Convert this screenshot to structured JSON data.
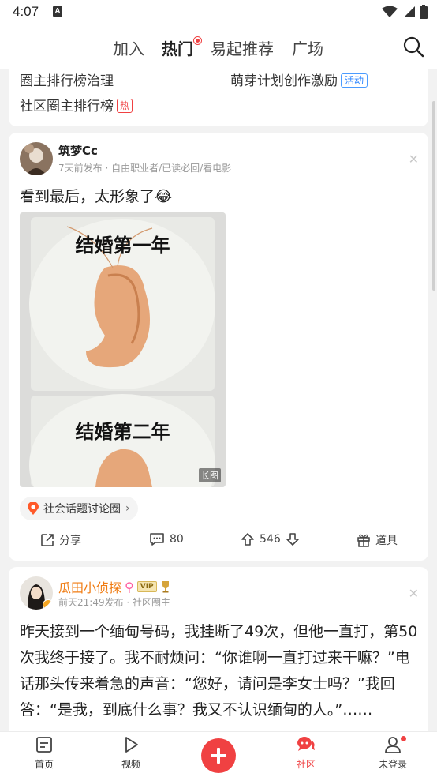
{
  "status_bar": {
    "time": "4:07",
    "badge": "A"
  },
  "top_nav": {
    "tabs": [
      {
        "label": "加入"
      },
      {
        "label": "热门",
        "active": true
      },
      {
        "label": "易起推荐"
      },
      {
        "label": "广场"
      }
    ]
  },
  "top_card": {
    "link1": "圈主排行榜治理",
    "link2": "社区圈主排行榜",
    "link2_tag": "热",
    "link3": "萌芽计划创作激励",
    "link3_tag": "活动"
  },
  "post1": {
    "author": "筑梦Cc",
    "meta": "7天前发布 · 自由职业者/已读必回/看电影",
    "text": "看到最后，太形象了😂",
    "image": {
      "caption1": "结婚第一年",
      "caption2": "结婚第二年",
      "long_badge": "长图"
    },
    "circle": "社会话题讨论圈",
    "actions": {
      "share": "分享",
      "comments": "80",
      "votes": "546",
      "props": "道具"
    }
  },
  "post2": {
    "author": "瓜田小侦探",
    "vip": "VIP",
    "meta": "前天21:49发布 · 社区圈主",
    "text": "昨天接到一个缅甸号码，我挂断了49次，但他一直打，第50次我终于接了。我不耐烦问：“你谁啊一直打过来干嘛？”电话那头传来着急的声音：“您好，请问是李女士吗？”我回答：“是我，到底什么事？我又不认识缅甸的人。”……"
  },
  "bottom_nav": {
    "items": [
      {
        "label": "首页"
      },
      {
        "label": "视频"
      },
      {
        "label": "社区",
        "active": true
      },
      {
        "label": "未登录"
      }
    ]
  },
  "colors": {
    "accent": "#f04142",
    "vip_orange": "#f07c13",
    "link_blue": "#2d86ff"
  }
}
